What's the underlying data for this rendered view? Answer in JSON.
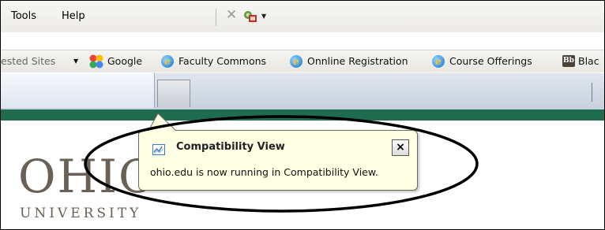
{
  "menu": {
    "tools_label": "Tools",
    "help_label": "Help"
  },
  "favorites_bar": {
    "suggested_sites_label": "ested Sites",
    "items": [
      {
        "label": "Google",
        "icon": "google-icon"
      },
      {
        "label": "Faculty Commons",
        "icon": "ie-page-icon"
      },
      {
        "label": "Onnline Registration",
        "icon": "ie-page-icon"
      },
      {
        "label": "Course Offerings",
        "icon": "ie-page-icon"
      },
      {
        "label": "Blac",
        "icon": "blackboard-icon",
        "icon_text": "Bb"
      }
    ]
  },
  "page": {
    "logo_main": "OHIO",
    "logo_sub": "UNIVERSITY"
  },
  "popup": {
    "title": "Compatibility View",
    "message": "ohio.edu is now running in Compatibility View.",
    "close_symbol": "×"
  },
  "colors": {
    "green_bar": "#1e6b4f",
    "popup_bg": "#ffffe4",
    "logo": "#6c6055"
  }
}
